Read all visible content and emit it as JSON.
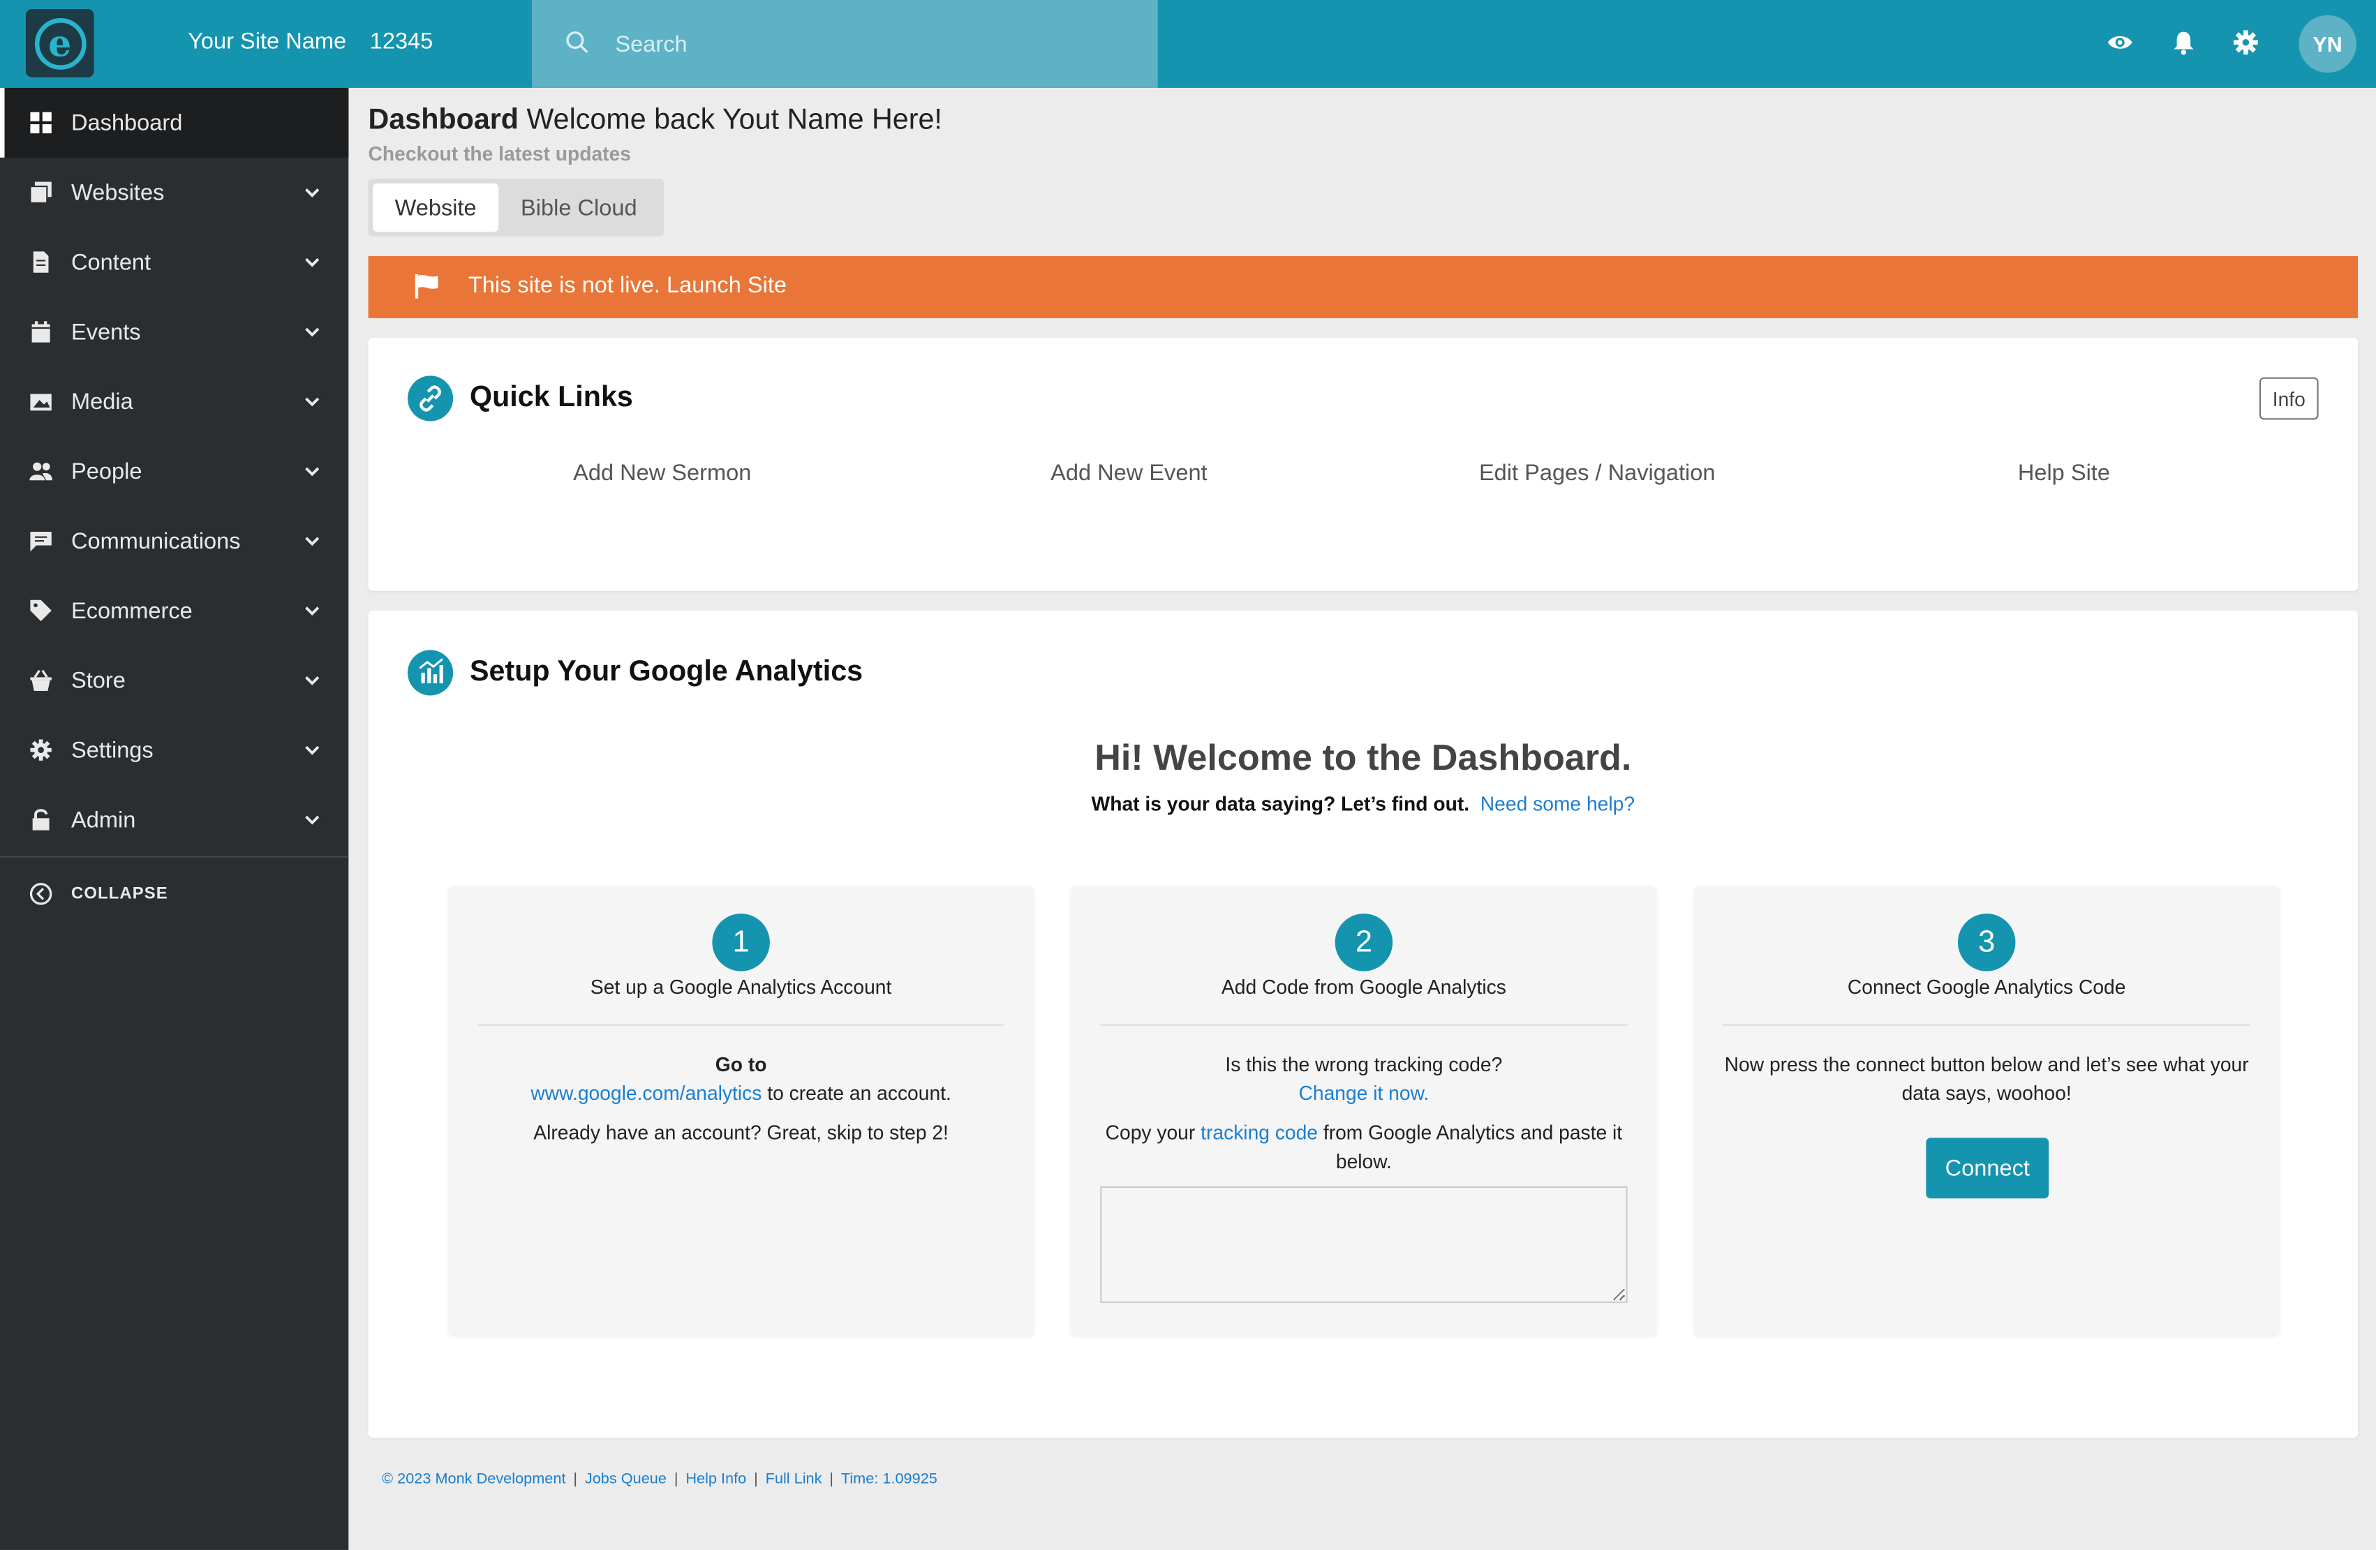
{
  "header": {
    "site_name": "Your Site Name",
    "site_id": "12345",
    "search_placeholder": "Search",
    "avatar_initials": "YN",
    "icons": [
      "eye-icon",
      "bell-icon",
      "gear-icon"
    ]
  },
  "sidebar": {
    "items": [
      {
        "label": "Dashboard",
        "icon": "dashboard-icon",
        "active": true
      },
      {
        "label": "Websites",
        "icon": "websites-icon"
      },
      {
        "label": "Content",
        "icon": "document-icon"
      },
      {
        "label": "Events",
        "icon": "calendar-icon"
      },
      {
        "label": "Media",
        "icon": "media-icon"
      },
      {
        "label": "People",
        "icon": "people-icon"
      },
      {
        "label": "Communications",
        "icon": "chat-icon"
      },
      {
        "label": "Ecommerce",
        "icon": "tag-icon"
      },
      {
        "label": "Store",
        "icon": "basket-icon"
      },
      {
        "label": "Settings",
        "icon": "gear-icon"
      },
      {
        "label": "Admin",
        "icon": "lock-icon"
      }
    ],
    "collapse_label": "COLLAPSE"
  },
  "main": {
    "title_bold": "Dashboard",
    "title_rest": "Welcome back Yout Name Here!",
    "subtitle": "Checkout the latest updates",
    "tabs": [
      {
        "label": "Website",
        "active": true
      },
      {
        "label": "Bible Cloud"
      }
    ],
    "alert": {
      "text": "This site is not live. Launch Site",
      "color": "#e97638"
    },
    "quick_links": {
      "title": "Quick Links",
      "info_label": "Info",
      "links": [
        "Add New Sermon",
        "Add New Event",
        "Edit Pages / Navigation",
        "Help Site"
      ]
    },
    "analytics": {
      "title": "Setup Your Google Analytics",
      "welcome": "Hi! Welcome to the Dashboard.",
      "question": "What is your data saying? Let’s find out.",
      "help_link": "Need some help?",
      "steps": [
        {
          "num": "1",
          "title": "Set up a Google Analytics Account",
          "go_to": "Go to",
          "link": "www.google.com/analytics",
          "after_link": " to create an account.",
          "extra": "Already have an account? Great, skip to step 2!"
        },
        {
          "num": "2",
          "title": "Add Code from Google Analytics",
          "question": "Is this the wrong tracking code?",
          "change_link": "Change it now.",
          "copy_pre": "Copy your ",
          "copy_link": "tracking code",
          "copy_post": " from Google Analytics and paste it below.",
          "code_value": ""
        },
        {
          "num": "3",
          "title": "Connect Google Analytics Code",
          "text": "Now press the connect button below and let’s see what your data says, woohoo!",
          "button": "Connect"
        }
      ]
    }
  },
  "footer": {
    "items": [
      "© 2023 Monk Development",
      "Jobs Queue",
      "Help Info",
      "Full Link",
      "Time: 1.09925"
    ]
  },
  "colors": {
    "brand": "#1594af",
    "sidebar": "#2b2e31",
    "alert": "#e97638",
    "link": "#1a7fd1"
  }
}
